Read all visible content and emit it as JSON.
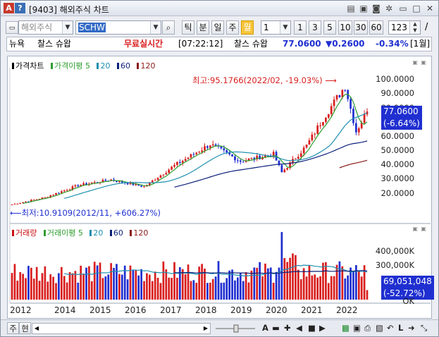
{
  "window": {
    "title": "[9403] 해외주식 차트",
    "app_icon": "A",
    "help_icon": "?",
    "title_buttons": [
      "edit-icon",
      "save-icon",
      "camera-icon",
      "settings-icon",
      "minimize-icon",
      "close-icon"
    ]
  },
  "toolbar": {
    "market_select": "해외주식",
    "symbol_input": "SCHW",
    "search_icon": "search-icon",
    "period_buttons": [
      "틱",
      "분",
      "일",
      "주",
      "월"
    ],
    "active_period": "월",
    "multiplier_select": "1",
    "quick_buttons": [
      "1",
      "3",
      "5",
      "10",
      "30",
      "60"
    ],
    "count_value": "123",
    "slash": "/"
  },
  "info_bar": {
    "market": "뉴욕",
    "name": "찰스 슈왑",
    "realtime": "무료실시간",
    "time": "[07:22:12]",
    "name2": "찰스 슈왑",
    "price": "77.0600",
    "change": "▼0.2600",
    "change_pct": "-0.34%",
    "period": "[1월]"
  },
  "price_panel": {
    "legend": [
      {
        "label": "가격차트",
        "color": "#000000"
      },
      {
        "label": "가격이평 5",
        "color": "#2e9d2e"
      },
      {
        "label": "20",
        "color": "#1f8fb0"
      },
      {
        "label": "60",
        "color": "#0b1f7a"
      },
      {
        "label": "120",
        "color": "#8b1a1a"
      }
    ],
    "y_labels": [
      "100.0000",
      "90.0000",
      "80.0000",
      "70.0000",
      "60.0000",
      "50.0000",
      "40.0000",
      "30.0000",
      "20.0000"
    ],
    "current_price": "77.0600",
    "current_pct": "(-6.64%)",
    "high_annotation": "최고:95.1766(2022/02, -19.03%)",
    "low_annotation": "최저:10.9109(2012/11, +606.27%)"
  },
  "volume_panel": {
    "legend": [
      {
        "label": "거래량",
        "color": "#cc1111"
      },
      {
        "label": "거래이평 5",
        "color": "#2e9d2e"
      },
      {
        "label": "20",
        "color": "#1f8fb0"
      },
      {
        "label": "60",
        "color": "#0b1f7a"
      },
      {
        "label": "120",
        "color": "#8b1a1a"
      }
    ],
    "y_labels": [
      "400,000K",
      "300,000K"
    ],
    "current_volume": "69,051,048",
    "current_pct": "(-52.72%)",
    "cut_label": "OK"
  },
  "x_axis": [
    "2012",
    "2014",
    "2015",
    "2016",
    "2017",
    "2018",
    "2019",
    "2020",
    "2021",
    "2022"
  ],
  "status_bar": {
    "left_labels": [
      "주",
      "현"
    ],
    "zoom_label": "A",
    "icons": [
      "scroll-left-icon",
      "scroll-right-icon",
      "minus-icon",
      "plus-icon",
      "stop-icon",
      "play-icon",
      "excel-icon",
      "save-icon",
      "print-icon",
      "chart-icon",
      "back-icon",
      "line-icon",
      "compress-icon"
    ]
  },
  "colors": {
    "up": "#d91e1e",
    "down": "#1f2fd0",
    "accent": "#f7c53b",
    "price_box": "#1f2fd0"
  },
  "chart_data": {
    "type": "candlestick+bar",
    "title": "",
    "xlabel": "",
    "ylabel": "",
    "ylim": [
      10,
      105
    ],
    "x_range": [
      "2012/02",
      "2022/10"
    ],
    "monthly_close_approx": [
      {
        "x": "2012/01",
        "y": 11.5
      },
      {
        "x": "2013/01",
        "y": 16.5
      },
      {
        "x": "2014/01",
        "y": 25
      },
      {
        "x": "2015/01",
        "y": 29
      },
      {
        "x": "2016/01",
        "y": 24
      },
      {
        "x": "2016/12",
        "y": 39
      },
      {
        "x": "2018/01",
        "y": 54
      },
      {
        "x": "2018/12",
        "y": 42
      },
      {
        "x": "2019/12",
        "y": 47
      },
      {
        "x": "2020/03",
        "y": 34
      },
      {
        "x": "2020/12",
        "y": 53
      },
      {
        "x": "2021/06",
        "y": 72
      },
      {
        "x": "2022/02",
        "y": 95.18
      },
      {
        "x": "2022/06",
        "y": 63
      },
      {
        "x": "2022/10",
        "y": 77.06
      }
    ],
    "volume_ylabels": [
      "300,000K",
      "400,000K"
    ]
  }
}
